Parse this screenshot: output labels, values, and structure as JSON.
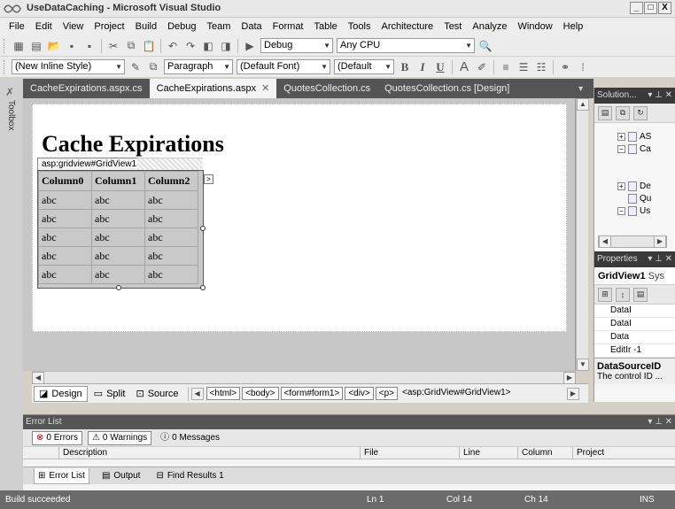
{
  "window": {
    "title": "UseDataCaching - Microsoft Visual Studio",
    "min": "_",
    "max": "□",
    "close": "X"
  },
  "menu": [
    "File",
    "Edit",
    "View",
    "Project",
    "Build",
    "Debug",
    "Team",
    "Data",
    "Format",
    "Table",
    "Tools",
    "Architecture",
    "Test",
    "Analyze",
    "Window",
    "Help"
  ],
  "toolbar1": {
    "config": "Debug",
    "platform": "Any CPU"
  },
  "toolbar2": {
    "style": "(New Inline Style)",
    "block": "Paragraph",
    "font": "(Default Font)",
    "size": "(Default",
    "bold": "B",
    "italic": "I",
    "underline": "U"
  },
  "toolbox_label": "Toolbox",
  "doc_tabs": [
    {
      "label": "CacheExpirations.aspx.cs"
    },
    {
      "label": "CacheExpirations.aspx",
      "close": "✕"
    },
    {
      "label": "QuotesCollection.cs"
    },
    {
      "label": "QuotesCollection.cs [Design]"
    }
  ],
  "designer": {
    "heading": "Cache Expirations",
    "gridview_tag": "asp:gridview#GridView1",
    "smart_tag": ">",
    "columns": [
      "Column0",
      "Column1",
      "Column2"
    ],
    "rows": [
      [
        "abc",
        "abc",
        "abc"
      ],
      [
        "abc",
        "abc",
        "abc"
      ],
      [
        "abc",
        "abc",
        "abc"
      ],
      [
        "abc",
        "abc",
        "abc"
      ],
      [
        "abc",
        "abc",
        "abc"
      ]
    ]
  },
  "view_bar": {
    "design": "Design",
    "split": "Split",
    "source": "Source",
    "breadcrumbs": [
      "<html>",
      "<body>",
      "<form#form1>",
      "<div>",
      "<p>",
      "<asp:GridView#GridView1>"
    ]
  },
  "solution": {
    "title": "Solution...",
    "items": [
      {
        "pm": "+",
        "label": "AS"
      },
      {
        "pm": "−",
        "label": "Ca"
      },
      {
        "pm": "+",
        "label": "De"
      },
      {
        "pm": "",
        "label": "Qu"
      },
      {
        "pm": "−",
        "label": "Us"
      }
    ]
  },
  "properties": {
    "title": "Properties",
    "object": "GridView1",
    "object_type": "Sys",
    "rows": [
      {
        "name": "DataI",
        "value": ""
      },
      {
        "name": "DataI",
        "value": ""
      },
      {
        "name": "Data",
        "value": ""
      },
      {
        "name": "EditIr",
        "value": "-1"
      }
    ],
    "desc_title": "DataSourceID",
    "desc_text": "The control ID ..."
  },
  "error_list": {
    "title": "Error List",
    "errors": "0 Errors",
    "warnings": "0 Warnings",
    "messages": "0 Messages",
    "headers": [
      "Description",
      "File",
      "Line",
      "Column",
      "Project"
    ]
  },
  "bottom_tabs": [
    "Error List",
    "Output",
    "Find Results 1"
  ],
  "status": {
    "message": "Build succeeded",
    "ln": "Ln 1",
    "col": "Col 14",
    "ch": "Ch 14",
    "mode": "INS"
  }
}
